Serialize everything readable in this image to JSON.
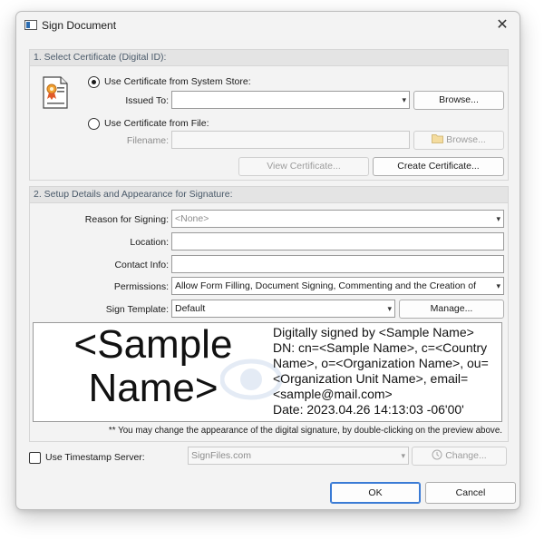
{
  "window": {
    "title": "Sign Document",
    "close_glyph": "✕"
  },
  "certificate_group": {
    "header": "1. Select Certificate (Digital ID):",
    "system_store_label": "Use Certificate from System Store:",
    "issued_to_label": "Issued To:",
    "issued_to_value": "",
    "browse_label": "Browse...",
    "file_label": "Use Certificate from File:",
    "filename_label": "Filename:",
    "filename_value": "",
    "browse_file_label": "Browse...",
    "view_certificate_label": "View Certificate...",
    "create_certificate_label": "Create Certificate...",
    "selected_source": "system_store"
  },
  "details_group": {
    "header": "2. Setup Details and Appearance for Signature:",
    "reason_label": "Reason for Signing:",
    "reason_value": "<None>",
    "location_label": "Location:",
    "location_value": "",
    "contact_label": "Contact Info:",
    "contact_value": "",
    "permissions_label": "Permissions:",
    "permissions_value": "Allow Form Filling, Document Signing, Commenting and the Creation of",
    "template_label": "Sign Template:",
    "template_value": "Default",
    "manage_label": "Manage...",
    "preview_name": "<Sample Name>",
    "preview_details": "Digitally signed by <Sample Name>\nDN: cn=<Sample Name>, c=<Country Name>, o=<Organization Name>, ou=<Organization Unit Name>, email=<sample@mail.com>\nDate: 2023.04.26 14:13:03 -06'00'",
    "note": "** You may change the appearance of the digital signature, by double-clicking on the preview above."
  },
  "timestamp": {
    "label": "Use Timestamp Server:",
    "checked": false,
    "server_value": "SignFiles.com",
    "change_label": "Change..."
  },
  "footer": {
    "ok_label": "OK",
    "cancel_label": "Cancel"
  },
  "icons": {
    "title": "window-icon",
    "certificate": "certificate-icon",
    "dropdown": "▾"
  },
  "colors": {
    "accent": "#3a7bd5",
    "group_header_bg": "#e4e4e4",
    "dialog_bg": "#f3f3f3"
  }
}
